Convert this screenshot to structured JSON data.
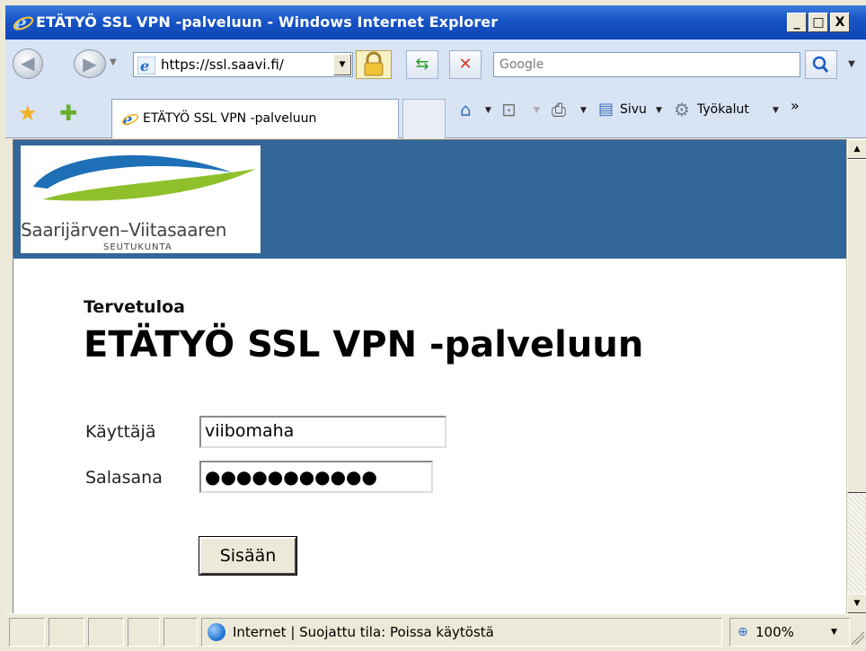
{
  "window": {
    "title": "ETÄTYÖ SSL VPN -palveluun - Windows Internet Explorer",
    "minimize_label": "_",
    "maximize_label": "□",
    "close_label": "X"
  },
  "address_bar": {
    "url": "https://ssl.saavi.fi/",
    "search_placeholder": "Google"
  },
  "tabs": [
    {
      "label": "ETÄTYÖ SSL VPN -palveluun"
    }
  ],
  "command_bar": {
    "page_label": "Sivu",
    "tools_label": "Työkalut",
    "overflow_label": "»"
  },
  "page": {
    "logo_text": "Saarijärven–Viitasaaren",
    "logo_subtext": "SEUTUKUNTA",
    "welcome": "Tervetuloa",
    "heading": "ETÄTYÖ SSL VPN -palveluun",
    "username_label": "Käyttäjä",
    "username_value": "viibomaha",
    "password_label": "Salasana",
    "password_mask": "●●●●●●●●●●●",
    "login_button": "Sisään"
  },
  "status_bar": {
    "zone_text": "Internet | Suojattu tila: Poissa käytöstä",
    "zoom": "100%"
  },
  "colors": {
    "header_band": "#336699",
    "titlebar": "#0d45b5"
  }
}
